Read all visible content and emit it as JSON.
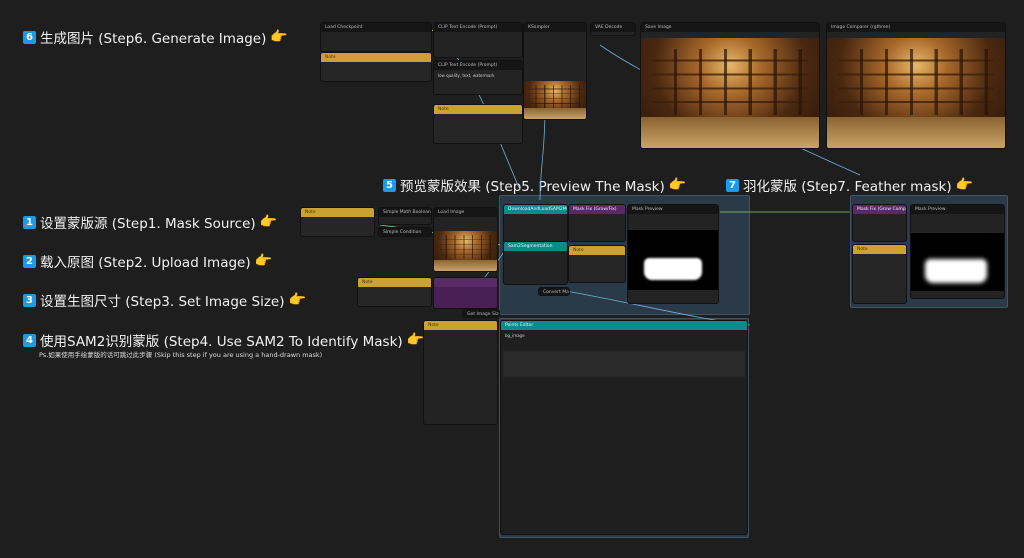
{
  "steps": [
    {
      "num": "6",
      "label": "生成图片 (Step6. Generate Image)"
    },
    {
      "num": "5",
      "label": "预览蒙版效果 (Step5. Preview The Mask)"
    },
    {
      "num": "7",
      "label": "羽化蒙版 (Step7. Feather mask)"
    },
    {
      "num": "1",
      "label": "设置蒙版源 (Step1. Mask Source)"
    },
    {
      "num": "2",
      "label": "载入原图 (Step2. Upload Image)"
    },
    {
      "num": "3",
      "label": "设置生图尺寸 (Step3. Set Image Size)"
    },
    {
      "num": "4",
      "label": "使用SAM2识别蒙版 (Step4. Use SAM2 To Identify Mask)"
    }
  ],
  "step4_note": "Ps.如果使用手绘蒙版的话可跳过此步骤 (Skip this step if you are using a hand-drawn mask)",
  "hand_icon": "👉",
  "nodes": {
    "load_checkpoint": "Load Checkpoint",
    "clip_pos": "CLIP Text Encode (Prompt)",
    "clip_neg": "CLIP Text Encode (Prompt)",
    "ksampler": "KSampler",
    "vae_decode": "VAE Decode",
    "save_image": "Save Image",
    "image_comparer": "Image Comparer (rgthree)",
    "note": "Note",
    "simple_math": "Simple Math Boolean",
    "simple_condition": "Simple Condition",
    "load_image": "Load Image",
    "get_image_size": "Get Image Size",
    "sam2_loader": "DownloadAndLoadSAM2Model",
    "sam2_seg": "Sam2Segmentation",
    "mask_fix": "Mask Fix (Grow/Fix)",
    "mask_preview": "Mask Preview",
    "points_editor": "Points Editor",
    "mask_fix_7": "Mask Fix (Grow Composite)",
    "mask_preview_7": "Mask Preview",
    "convert_mask": "Convert Mask"
  },
  "clip_neg_text": "low quality, text, watermark",
  "points_editor_output": "bg_image"
}
